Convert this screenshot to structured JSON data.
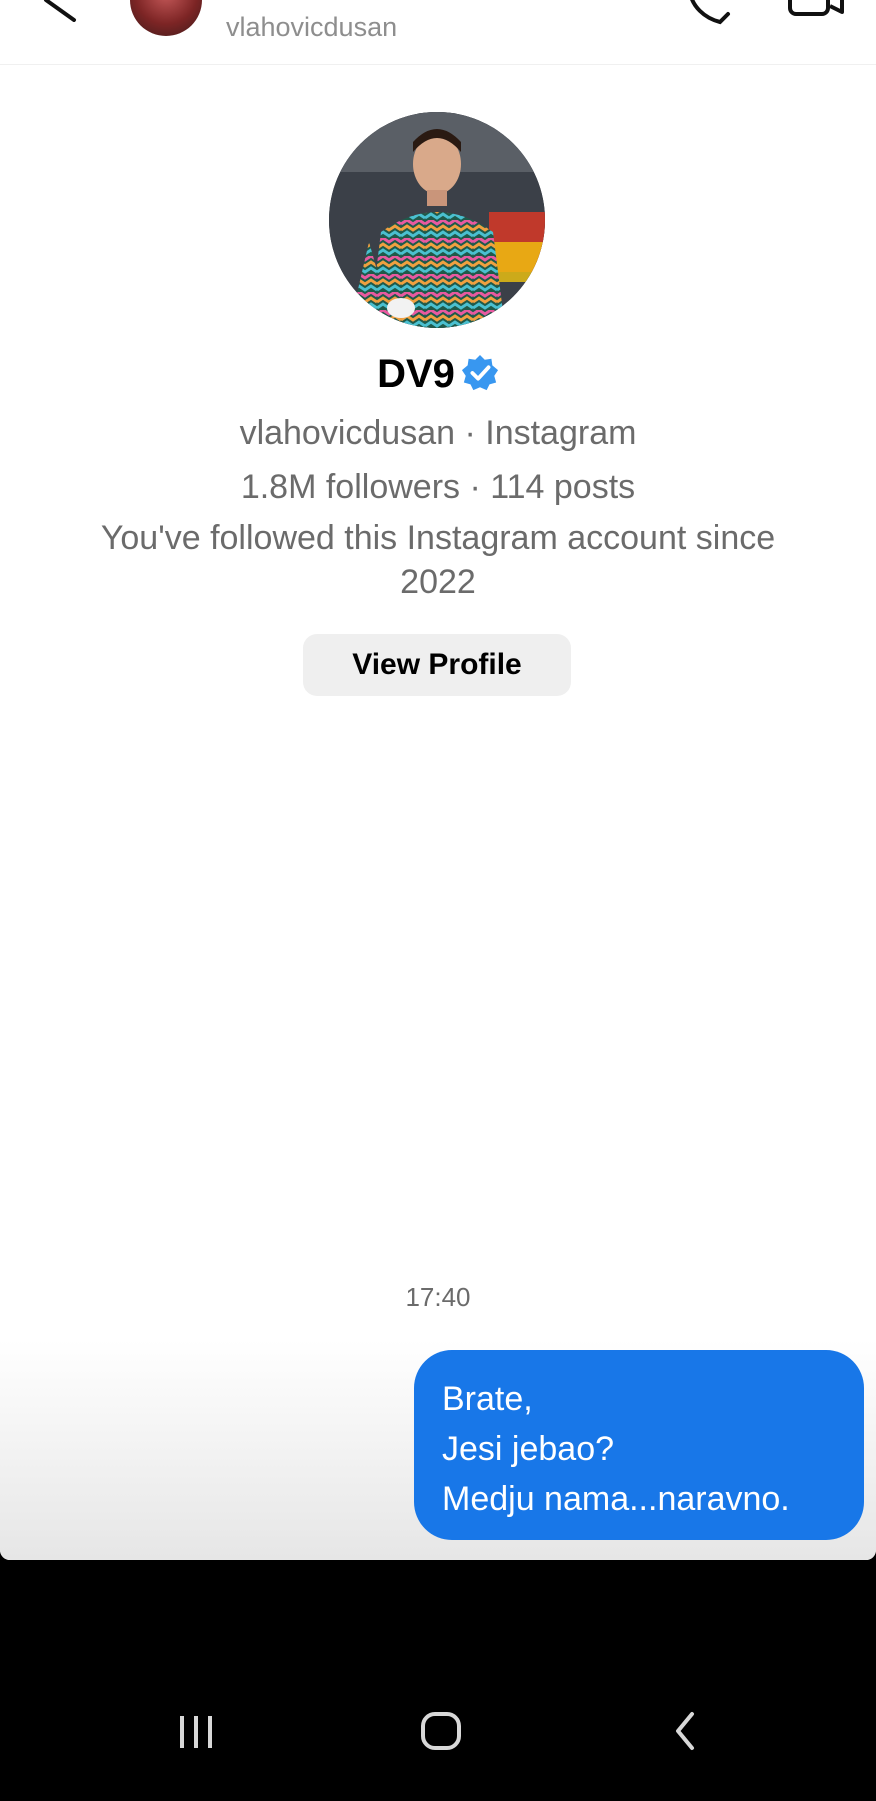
{
  "header": {
    "username": "vlahovicdusan"
  },
  "profile": {
    "display_name": "DV9",
    "source_line": "vlahovicdusan · Instagram",
    "stats_line": "1.8M followers · 114 posts",
    "followed_line_1": "You've followed this Instagram account since",
    "followed_line_2": "2022",
    "view_profile_label": "View Profile",
    "verified_color": "#3897f0"
  },
  "thread": {
    "timestamp": "17:40",
    "message": {
      "line1": "Brate,",
      "line2": "Jesi jebao?",
      "line3": "Medju nama...naravno."
    },
    "bubble_color": "#1877e8"
  },
  "system_nav": {
    "icons": [
      "recent-apps-icon",
      "home-icon",
      "back-icon"
    ]
  }
}
